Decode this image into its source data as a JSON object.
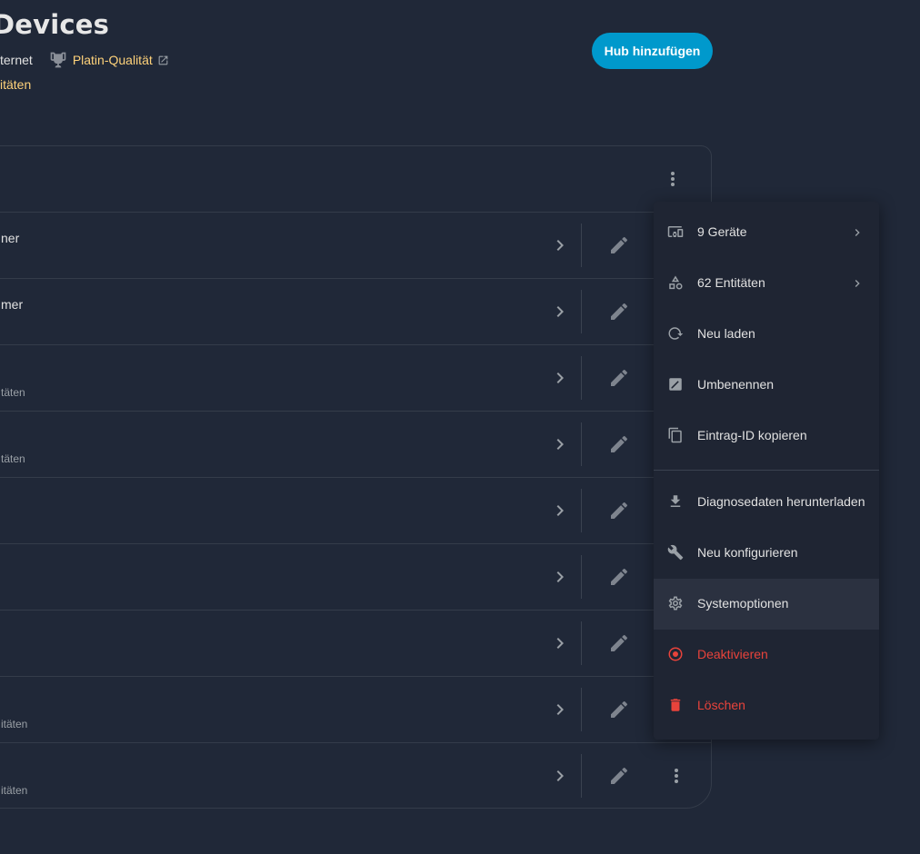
{
  "header": {
    "title": "Devices",
    "connection": "ternet",
    "quality_label": "Platin-Qualität",
    "entities_link": "itäten",
    "add_hub_label": "Hub hinzufügen"
  },
  "rows": [
    {
      "name": "ner",
      "sub": ""
    },
    {
      "name": "mer",
      "sub": ""
    },
    {
      "name": "",
      "sub": "täten"
    },
    {
      "name": "",
      "sub": "täten"
    },
    {
      "name": "",
      "sub": ""
    },
    {
      "name": "",
      "sub": ""
    },
    {
      "name": "",
      "sub": ""
    },
    {
      "name": "",
      "sub": "itäten"
    },
    {
      "name": "",
      "sub": "itäten"
    }
  ],
  "menu": {
    "devices": "9 Geräte",
    "entities": "62 Entitäten",
    "reload": "Neu laden",
    "rename": "Umbenennen",
    "copy_id": "Eintrag-ID kopieren",
    "diagnostics": "Diagnosedaten herunterladen",
    "reconfigure": "Neu konfigurieren",
    "system_options": "Systemoptionen",
    "disable": "Deaktivieren",
    "delete": "Löschen"
  },
  "colors": {
    "background": "#202838",
    "accent": "#0099cc",
    "link": "#ffd27a",
    "danger": "#e8433b"
  }
}
